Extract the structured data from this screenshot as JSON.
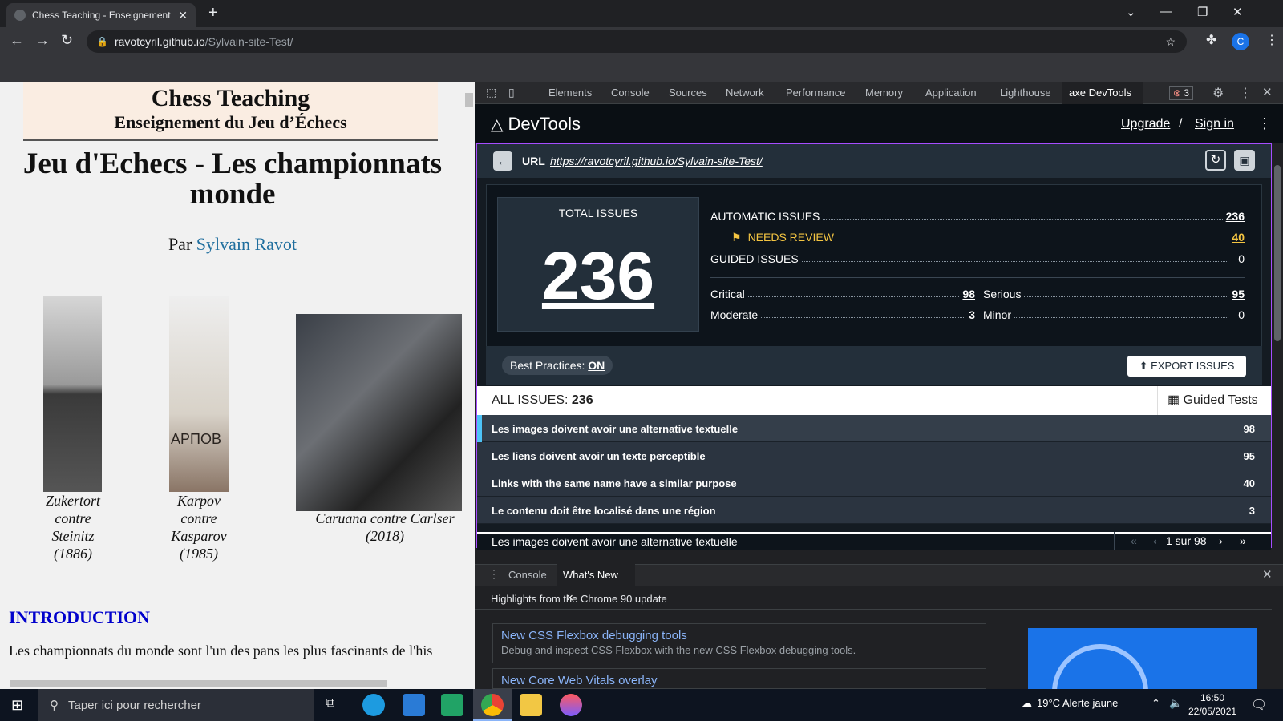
{
  "browser": {
    "tab_title": "Chess Teaching - Enseignement d",
    "url_host": "ravotcyril.github.io",
    "url_path": "/Sylvain-site-Test/",
    "profile_initial": "C"
  },
  "page": {
    "banner_title": "Chess Teaching",
    "banner_subtitle": "Enseignement du Jeu d’Échecs",
    "heading": "Jeu d'Echecs - Les championnats monde",
    "author_prefix": "Par",
    "author_name": "Sylvain Ravot",
    "captions": [
      {
        "line1": "Zukertort",
        "line2": "contre",
        "line3": "Steinitz",
        "line4": "(1886)"
      },
      {
        "line1": "Karpov",
        "line2": "contre",
        "line3": "Kasparov",
        "line4": "(1985)"
      },
      {
        "line1": "Caruana contre Carlser",
        "line2": "(2018)"
      }
    ],
    "photo_text": "АРПОВ",
    "intro_heading": "INTRODUCTION",
    "intro_text": "Les championnats du monde sont l'un des pans les plus fascinants de l'his"
  },
  "devtools": {
    "tabs": [
      "Elements",
      "Console",
      "Sources",
      "Network",
      "Performance",
      "Memory",
      "Application",
      "Lighthouse",
      "axe DevTools"
    ],
    "error_count": "3",
    "axe": {
      "logo": "DevTools",
      "upgrade": "Upgrade",
      "separator": "/",
      "signin": "Sign in",
      "url_label": "URL",
      "url_value": "https://ravotcyril.github.io/Sylvain-site-Test/",
      "total_label": "TOTAL ISSUES",
      "total_value": "236",
      "automatic_label": "AUTOMATIC ISSUES",
      "automatic_value": "236",
      "needs_review_label": "NEEDS REVIEW",
      "needs_review_value": "40",
      "guided_label": "GUIDED ISSUES",
      "guided_value": "0",
      "critical_label": "Critical",
      "critical_value": "98",
      "serious_label": "Serious",
      "serious_value": "95",
      "moderate_label": "Moderate",
      "moderate_value": "3",
      "minor_label": "Minor",
      "minor_value": "0",
      "best_practices_label": "Best Practices:",
      "best_practices_value": "ON",
      "export_label": "EXPORT ISSUES",
      "all_issues_label": "ALL ISSUES:",
      "all_issues_value": "236",
      "guided_tests_label": "Guided Tests",
      "issues": [
        {
          "label": "Les images doivent avoir une alternative textuelle",
          "count": "98"
        },
        {
          "label": "Les liens doivent avoir un texte perceptible",
          "count": "95"
        },
        {
          "label": "Links with the same name have a similar purpose",
          "count": "40"
        },
        {
          "label": "Le contenu doit être localisé dans une région",
          "count": "3"
        }
      ],
      "detail_title": "Les images doivent avoir une alternative textuelle",
      "pager": "1 sur 98"
    },
    "drawer": {
      "tabs": [
        "Console",
        "What's New"
      ],
      "highlights": "Highlights from the Chrome 90 update",
      "cards": [
        {
          "title": "New CSS Flexbox debugging tools",
          "desc": "Debug and inspect CSS Flexbox with the new CSS Flexbox debugging tools."
        },
        {
          "title": "New Core Web Vitals overlay",
          "desc": ""
        }
      ]
    }
  },
  "taskbar": {
    "search_placeholder": "Taper ici pour rechercher",
    "weather": "19°C  Alerte jaune",
    "time": "16:50",
    "date": "22/05/2021"
  }
}
